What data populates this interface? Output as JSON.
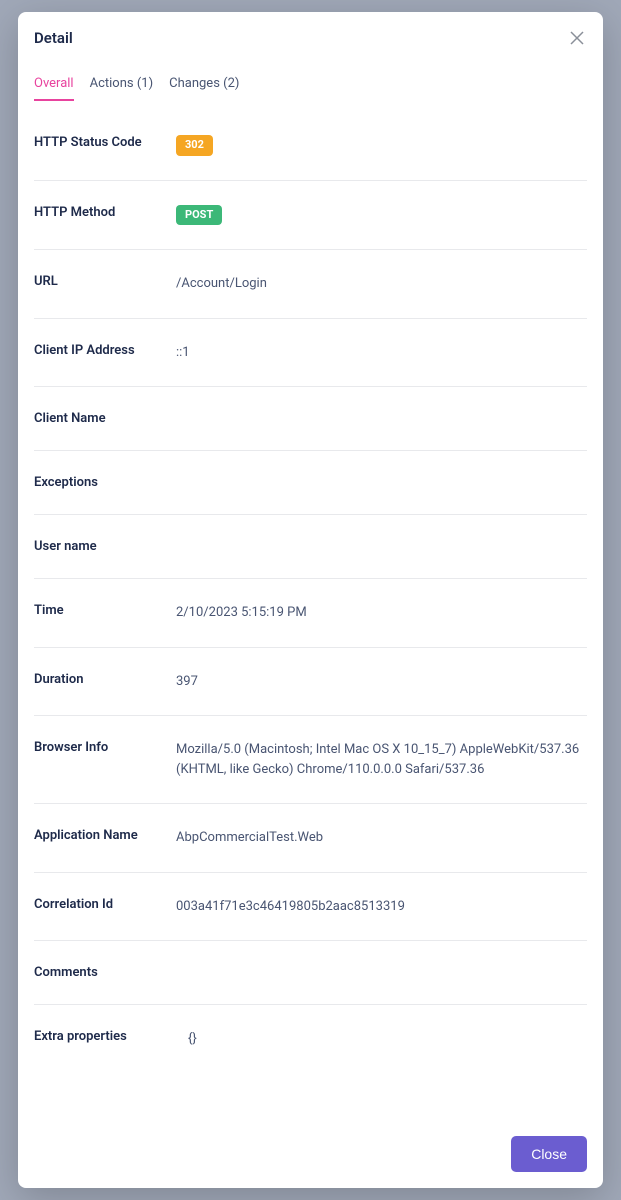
{
  "modal": {
    "title": "Detail",
    "closeButtonLabel": "Close"
  },
  "tabs": [
    {
      "label": "Overall",
      "active": true
    },
    {
      "label": "Actions (1)",
      "active": false
    },
    {
      "label": "Changes (2)",
      "active": false
    }
  ],
  "fields": {
    "httpStatusCode": {
      "label": "HTTP Status Code",
      "value": "302",
      "badge": "orange"
    },
    "httpMethod": {
      "label": "HTTP Method",
      "value": "POST",
      "badge": "green"
    },
    "url": {
      "label": "URL",
      "value": "/Account/Login"
    },
    "clientIp": {
      "label": "Client IP Address",
      "value": "::1"
    },
    "clientName": {
      "label": "Client Name",
      "value": ""
    },
    "exceptions": {
      "label": "Exceptions",
      "value": ""
    },
    "userName": {
      "label": "User name",
      "value": ""
    },
    "time": {
      "label": "Time",
      "value": "2/10/2023 5:15:19 PM"
    },
    "duration": {
      "label": "Duration",
      "value": "397"
    },
    "browserInfo": {
      "label": "Browser Info",
      "value": "Mozilla/5.0 (Macintosh; Intel Mac OS X 10_15_7) AppleWebKit/537.36 (KHTML, like Gecko) Chrome/110.0.0.0 Safari/537.36"
    },
    "applicationName": {
      "label": "Application Name",
      "value": "AbpCommercialTest.Web"
    },
    "correlationId": {
      "label": "Correlation Id",
      "value": "003a41f71e3c46419805b2aac8513319"
    },
    "comments": {
      "label": "Comments",
      "value": ""
    },
    "extraProperties": {
      "label": "Extra properties",
      "value": "{}"
    }
  }
}
